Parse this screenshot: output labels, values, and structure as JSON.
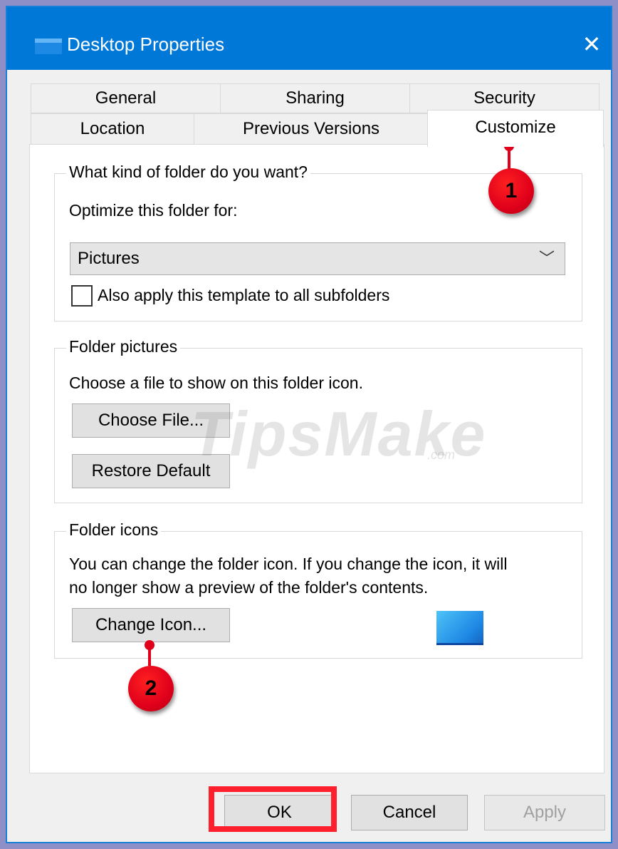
{
  "window": {
    "title": "Desktop Properties"
  },
  "tabs": {
    "back_row": [
      "General",
      "Sharing",
      "Security"
    ],
    "front_row": [
      "Location",
      "Previous Versions",
      "Customize"
    ],
    "active": "Customize"
  },
  "folder_type": {
    "legend": "What kind of folder do you want?",
    "optimize_label": "Optimize this folder for:",
    "selected": "Pictures",
    "apply_checkbox_label": "Also apply this template to all subfolders",
    "apply_checked": false
  },
  "folder_pictures": {
    "legend": "Folder pictures",
    "description": "Choose a file to show on this folder icon.",
    "choose_file_label": "Choose File...",
    "restore_default_label": "Restore Default"
  },
  "folder_icons": {
    "legend": "Folder icons",
    "description_line1": "You can change the folder icon. If you change the icon, it will",
    "description_line2": "no longer show a preview of the folder's contents.",
    "change_icon_label": "Change Icon..."
  },
  "footer": {
    "ok_label": "OK",
    "cancel_label": "Cancel",
    "apply_label": "Apply"
  },
  "annotations": {
    "marker_1": "1",
    "marker_2": "2"
  },
  "watermark": {
    "brand": "TipsMake",
    "suffix": ".com"
  },
  "colors": {
    "titlebar": "#0078d7",
    "marker": "#e0001b",
    "highlight": "#ff1f2d"
  }
}
